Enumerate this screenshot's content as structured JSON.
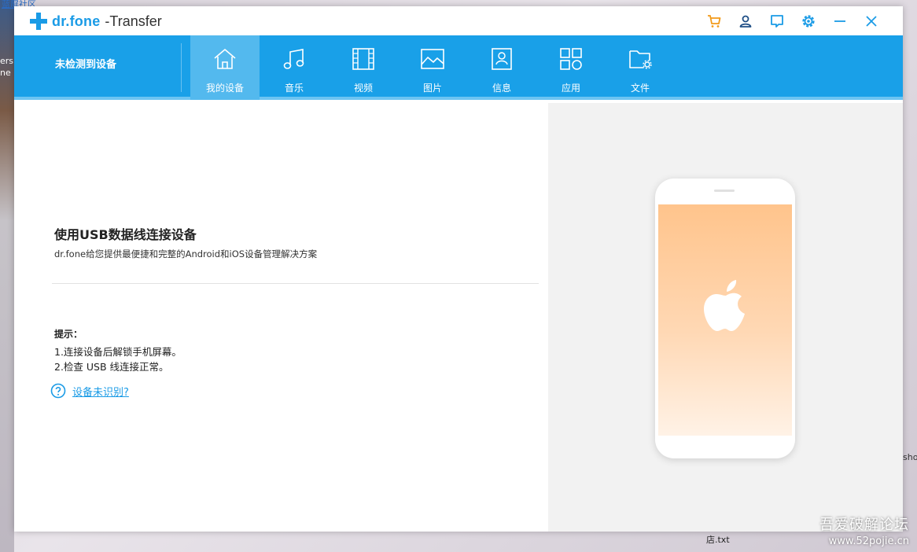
{
  "desktop": {
    "topleft_text": "蓝屏社区",
    "left_text": "ers\nne",
    "right_text": "sho",
    "file_label": "店.txt",
    "watermark_line1": "吾爱破解论坛",
    "watermark_line2": "www.52pojie.cn"
  },
  "app": {
    "brand": "dr.fone",
    "product": "-Transfer",
    "accent_color": "#1a9be6",
    "titlebar_icons": [
      "cart-icon",
      "user-icon",
      "feedback-icon",
      "settings-icon",
      "minimize-icon",
      "close-icon"
    ]
  },
  "nav": {
    "device_status": "未检测到设备",
    "tabs": [
      {
        "label": "我的设备",
        "icon": "home-icon",
        "active": true
      },
      {
        "label": "音乐",
        "icon": "music-icon",
        "active": false
      },
      {
        "label": "视频",
        "icon": "video-icon",
        "active": false
      },
      {
        "label": "图片",
        "icon": "photo-icon",
        "active": false
      },
      {
        "label": "信息",
        "icon": "contact-card-icon",
        "active": false
      },
      {
        "label": "应用",
        "icon": "apps-icon",
        "active": false
      },
      {
        "label": "文件",
        "icon": "folder-settings-icon",
        "active": false
      }
    ]
  },
  "main": {
    "headline": "使用USB数据线连接设备",
    "subline": "dr.fone给您提供最便捷和完整的Android和iOS设备管理解决方案",
    "tips_title": "提示：",
    "tips": [
      "1.连接设备后解锁手机屏幕。",
      "2.检查 USB 线连接正常。"
    ],
    "help_link": "设备未识别?"
  }
}
